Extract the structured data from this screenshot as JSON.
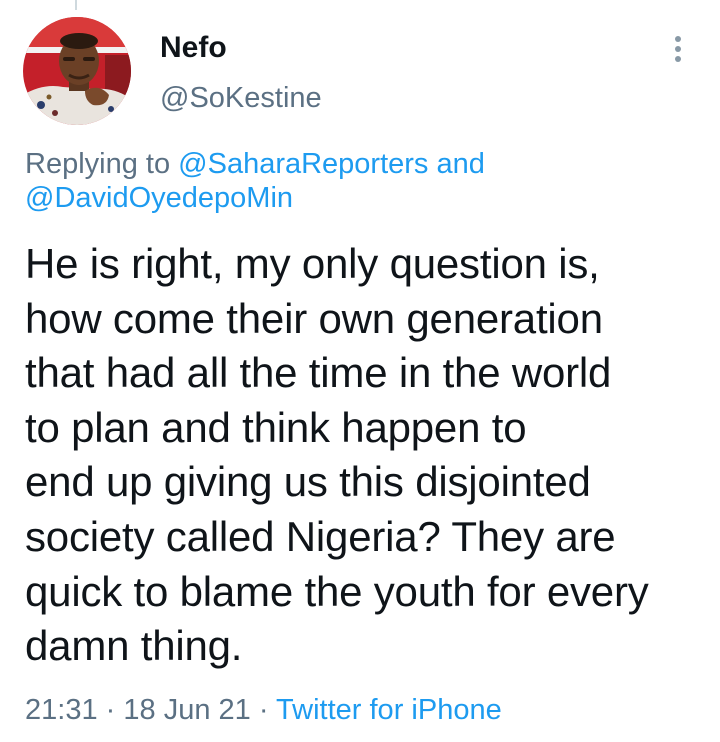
{
  "tweet": {
    "author": {
      "display_name": "Nefo",
      "handle": "@SoKestine",
      "avatar": "avatar-photo"
    },
    "reply_context": {
      "prefix": "Replying to",
      "mention_1": "@SaharaReporters",
      "conjunction": "and",
      "mention_2": "@DavidOyedepoMin"
    },
    "text": "He is right, my only question is,\nhow come their own generation\nthat had all the time in the world\nto plan and think happen to\nend up giving us this disjointed\nsociety called Nigeria? They are\nquick to blame the youth for every\ndamn thing.",
    "time": "21:31",
    "separator": "·",
    "date": "18 Jun 21",
    "source": "Twitter for iPhone",
    "more_icon": "more-vertical-icon"
  },
  "colors": {
    "text_primary": "#0f1419",
    "text_secondary": "#5b7083",
    "link": "#1d9bf0",
    "background": "#ffffff"
  }
}
